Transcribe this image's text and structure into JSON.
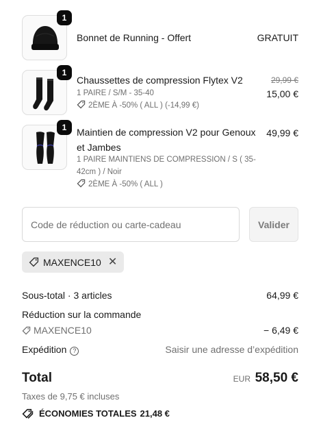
{
  "items": [
    {
      "quantity": "1",
      "name": "Bonnet de Running - Offert",
      "price": "GRATUIT",
      "image_icon": "beanie-icon"
    },
    {
      "quantity": "1",
      "name": "Chaussettes de compression Flytex V2",
      "variant": "1 PAIRE / S/M - 35-40",
      "discount": "2ÈME À -50% ( ALL ) (-14,99 €)",
      "original_price": "29,99 €",
      "price": "15,00 €",
      "image_icon": "socks-icon"
    },
    {
      "quantity": "1",
      "name_line1": "Maintien de compression V2 pour Genoux",
      "name_line2": "et Jambes",
      "variant_line1": "1 PAIRE MAINTIENS DE COMPRESSION / S ( 35-",
      "variant_line2": "42cm ) / Noir",
      "discount": "2ÈME À -50% ( ALL )",
      "price": "49,99 €",
      "image_icon": "leg-sleeves-icon"
    }
  ],
  "discount_form": {
    "placeholder": "Code de réduction ou carte-cadeau",
    "apply_label": "Valider"
  },
  "applied_code": {
    "code": "MAXENCE10",
    "remove_symbol": "✕"
  },
  "summary": {
    "subtotal_label": "Sous-total · 3 articles",
    "subtotal_value": "64,99 €",
    "order_discount_label": "Réduction sur la commande",
    "order_discount_code": "MAXENCE10",
    "order_discount_value": "− 6,49 €",
    "shipping_label": "Expédition",
    "shipping_help": "?",
    "shipping_value": "Saisir une adresse d’expédition",
    "total_label": "Total",
    "currency": "EUR",
    "total_value": "58,50 €",
    "taxes": "Taxes de 9,75 € incluses",
    "savings_label": "ÉCONOMIES TOTALES",
    "savings_value": "21,48 €"
  },
  "colors": {
    "text": "#1a1a1a",
    "muted": "#6f6f6f",
    "badge": "#0b0b0b",
    "chip": "#eaeaea"
  }
}
